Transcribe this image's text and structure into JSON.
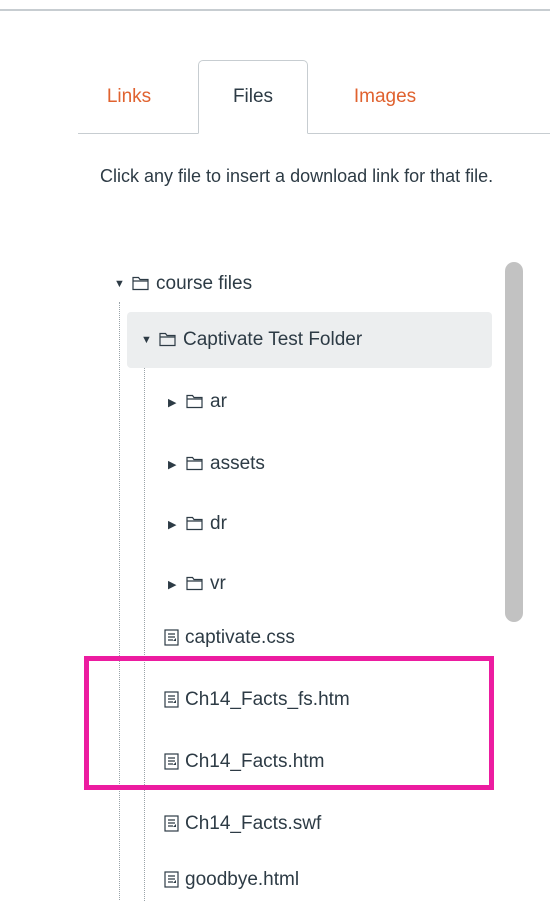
{
  "tabs": {
    "links": "Links",
    "files": "Files",
    "images": "Images"
  },
  "instructions": "Click any file to insert a download link for that file.",
  "tree": {
    "root": "course files",
    "folder": "Captivate Test Folder",
    "subfolders": [
      "ar",
      "assets",
      "dr",
      "vr"
    ],
    "files": [
      "captivate.css",
      "Ch14_Facts_fs.htm",
      "Ch14_Facts.htm",
      "Ch14_Facts.swf",
      "goodbye.html"
    ]
  },
  "colors": {
    "tab_link": "#e0622f",
    "highlight": "#ec1ca0",
    "selected_row": "#eceeef"
  },
  "icons": {
    "expanded": "triangle-down",
    "collapsed": "triangle-right",
    "folder": "folder-outline",
    "file": "document"
  }
}
